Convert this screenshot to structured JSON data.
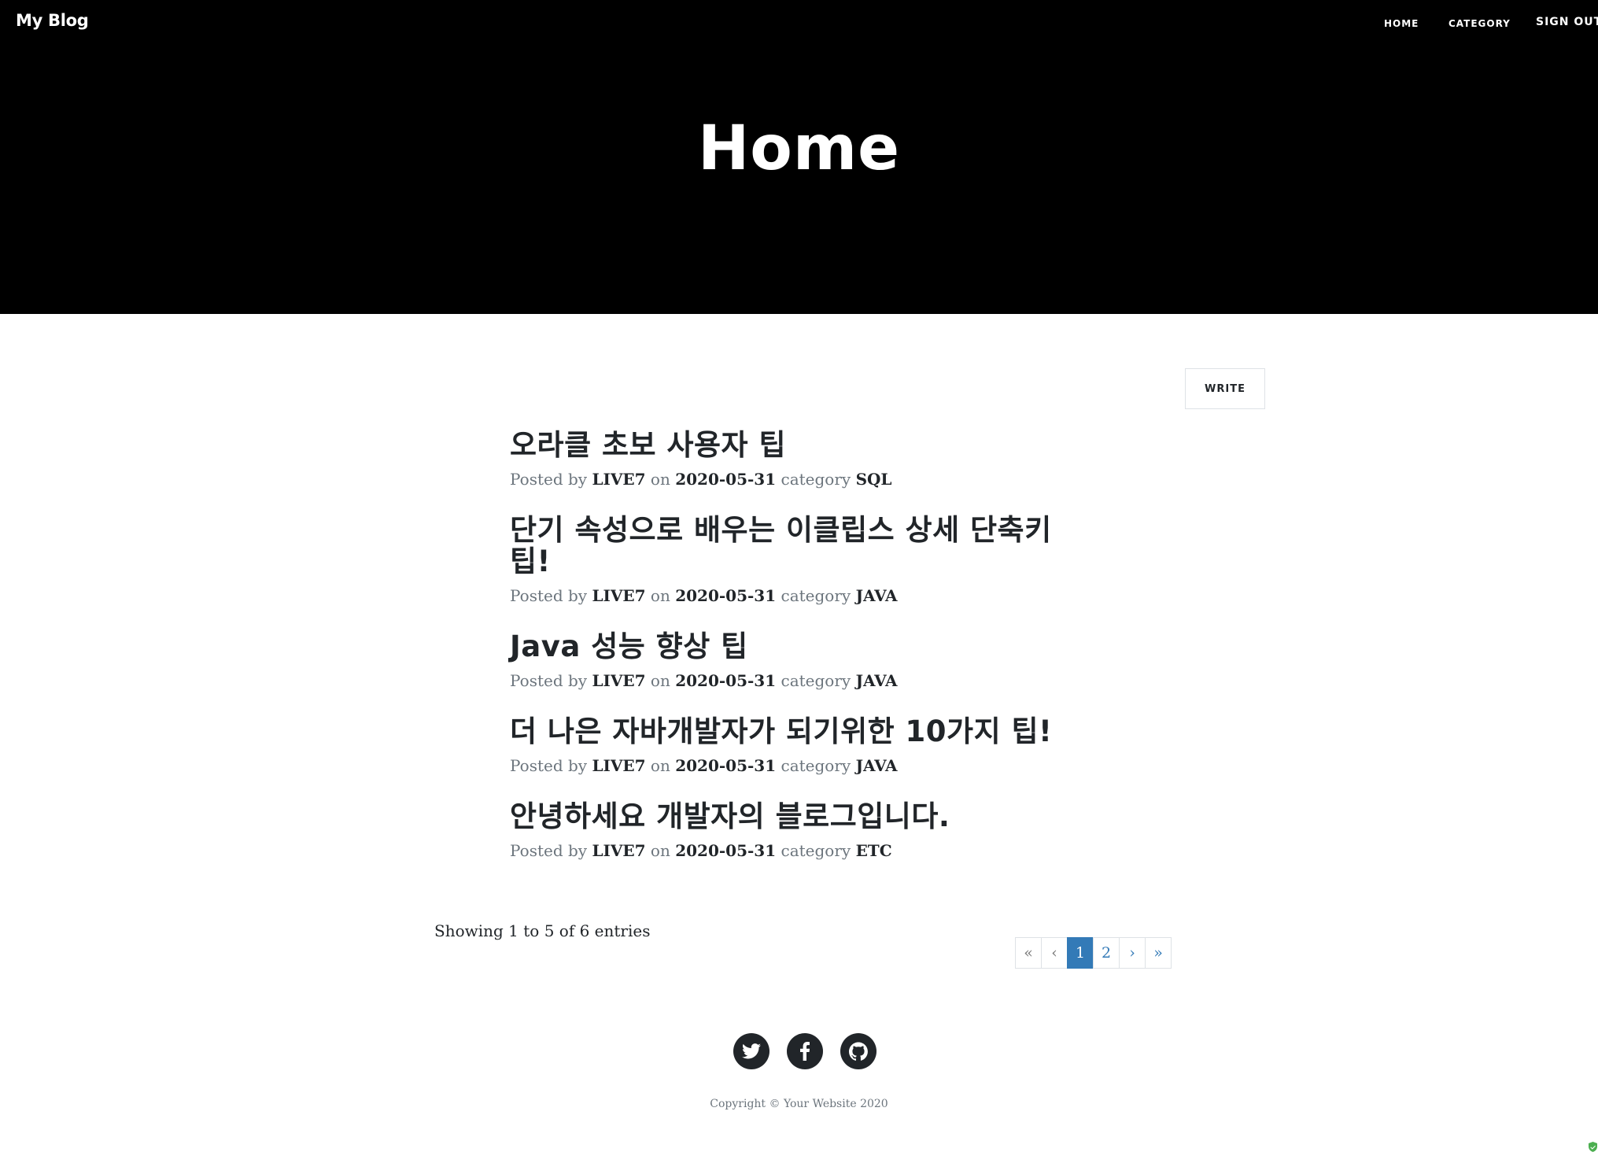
{
  "navbar": {
    "brand": "My Blog",
    "links": [
      {
        "label": "HOME"
      },
      {
        "label": "CATEGORY"
      },
      {
        "label": "SIGN OUT"
      }
    ]
  },
  "header": {
    "title": "Home"
  },
  "toolbar": {
    "write_label": "WRITE"
  },
  "posts": [
    {
      "title": "오라클 초보 사용자 팁",
      "prefix": "Posted by",
      "author": "LIVE7",
      "on": "on",
      "date": "2020-05-31",
      "category_word": "category",
      "category": "SQL"
    },
    {
      "title": "단기 속성으로 배우는 이클립스 상세 단축키 팁!",
      "prefix": "Posted by",
      "author": "LIVE7",
      "on": "on",
      "date": "2020-05-31",
      "category_word": "category",
      "category": "JAVA"
    },
    {
      "title": "Java 성능 향상 팁",
      "prefix": "Posted by",
      "author": "LIVE7",
      "on": "on",
      "date": "2020-05-31",
      "category_word": "category",
      "category": "JAVA"
    },
    {
      "title": "더 나은 자바개발자가 되기위한 10가지 팁!",
      "prefix": "Posted by",
      "author": "LIVE7",
      "on": "on",
      "date": "2020-05-31",
      "category_word": "category",
      "category": "JAVA"
    },
    {
      "title": "안녕하세요 개발자의 블로그입니다.",
      "prefix": "Posted by",
      "author": "LIVE7",
      "on": "on",
      "date": "2020-05-31",
      "category_word": "category",
      "category": "ETC"
    }
  ],
  "pagination": {
    "info": "Showing 1 to 5 of 6 entries",
    "first": "«",
    "prev": "‹",
    "pages": [
      "1",
      "2"
    ],
    "current_page": "1",
    "next": "›",
    "last": "»"
  },
  "footer": {
    "social": [
      "twitter-icon",
      "facebook-icon",
      "github-icon"
    ],
    "copyright": "Copyright © Your Website 2020"
  },
  "colors": {
    "header_bg": "#000000",
    "accent": "#337ab7",
    "text": "#212529",
    "muted": "#6c757d"
  }
}
